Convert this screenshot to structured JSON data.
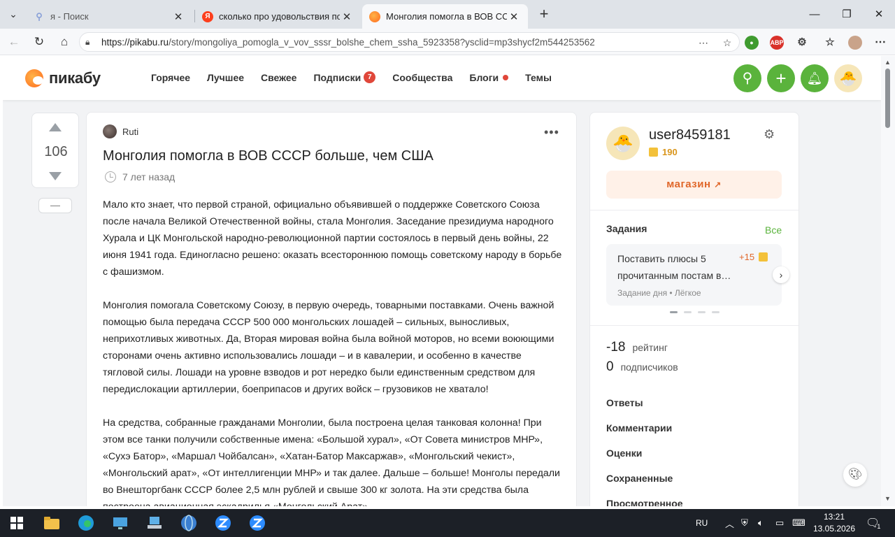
{
  "browser": {
    "tabs": [
      {
        "title": "я - Поиск",
        "favicon": "search-icon"
      },
      {
        "title": "сколько про удовольствия поста",
        "favicon": "yandex-icon"
      },
      {
        "title": "Монголия помогла в ВОВ СССР б",
        "favicon": "pikabu-icon"
      }
    ],
    "url_host": "https://pikabu.ru",
    "url_path": "/story/mongoliya_pomogla_v_vov_sssr_bolshe_chem_ssha_5923358?ysclid=mp3shycf2m544253562",
    "ext_abp": "ABP"
  },
  "site": {
    "logo": "пикабу",
    "nav": [
      {
        "label": "Горячее"
      },
      {
        "label": "Лучшее"
      },
      {
        "label": "Свежее"
      },
      {
        "label": "Подписки",
        "badge": "7"
      },
      {
        "label": "Сообщества"
      },
      {
        "label": "Блоги",
        "dot": true
      },
      {
        "label": "Темы"
      }
    ],
    "accent": "#5ab33c"
  },
  "vote": {
    "count": "106",
    "collapse": "—"
  },
  "article": {
    "author": "Ruti",
    "title": "Монголия помогла в ВОВ СССР больше, чем США",
    "time": "7 лет назад",
    "paragraphs": [
      "Мало кто знает, что первой страной, официально объявившей о поддержке Советского Союза после начала Великой Отечественной войны, стала Монголия. Заседание президиума народного Хурала и ЦК Монгольской народно-революционной партии состоялось в первый день войны, 22 июня 1941 года. Единогласно решено: оказать всестороннюю помощь советскому народу в борьбе с фашизмом.",
      "Монголия помогала Советскому Союзу, в первую очередь, товарными поставками. Очень важной помощью была передача СССР 500 000 монгольских лошадей – сильных, выносливых, неприхотливых животных. Да, Вторая мировая война была войной моторов, но всеми воюющими сторонами очень активно использовались лошади – и в кавалерии, и особенно в качестве тягловой силы. Лошади на уровне взводов и рот нередко были единственным средством для передислокации артиллерии, боеприпасов и других войск – грузовиков не хватало!",
      "На средства, собранные гражданами Монголии, была построена целая танковая колонна! При этом все танки получили собственные имена: «Большой хурал», «От Совета министров МНР», «Сухэ Батор», «Маршал Чойбалсан», «Хатан-Батор Максаржав», «Монгольский чекист», «Монгольский арат», «От интеллигенции МНР» и так далее. Дальше – больше! Монголы передали во Внешторгбанк СССР более 2,5 млн рублей и свыше 300 кг золота. На эти средства была построена авиационная эскадрилья «Монгольский Арат»."
    ]
  },
  "sidebar": {
    "username": "user8459181",
    "coins": "190",
    "shop": "магазин",
    "tasks_heading": "Задания",
    "tasks_all": "Все",
    "task": {
      "text": "Поставить плюсы 5 прочитанным постам в…",
      "reward": "+15",
      "meta": "Задание дня  •  Лёгкое"
    },
    "rating_value": "-18",
    "rating_label": "рейтинг",
    "subs_value": "0",
    "subs_label": "подписчиков",
    "links": [
      "Ответы",
      "Комментарии",
      "Оценки",
      "Сохраненные",
      "Просмотренное"
    ]
  },
  "taskbar": {
    "lang": "RU",
    "time": "13:21",
    "date": "13.05.2026",
    "notif": "1"
  }
}
